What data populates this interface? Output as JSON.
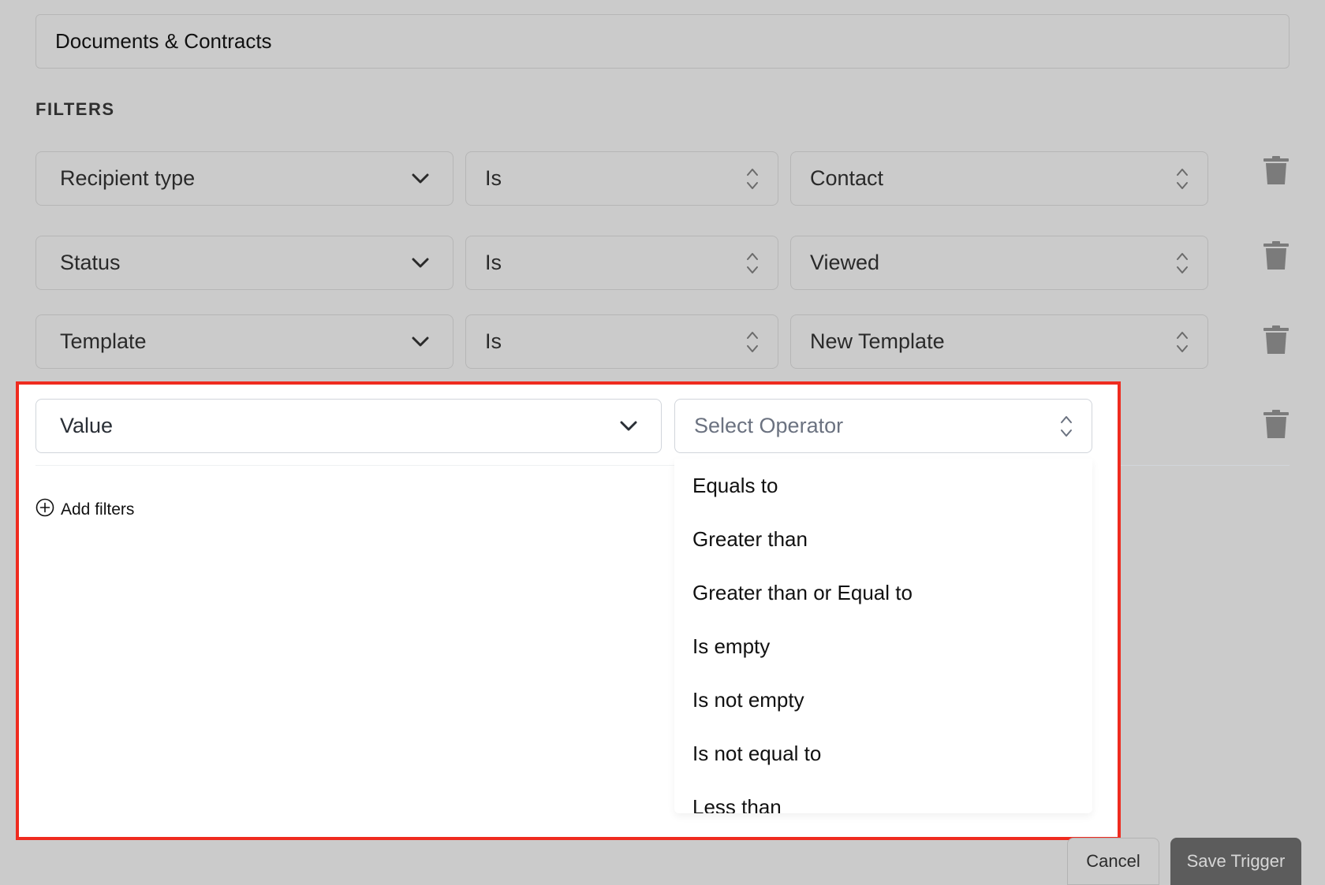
{
  "trigger_name": "Documents & Contracts",
  "filters_heading": "FILTERS",
  "filter_rows": [
    {
      "field": "Recipient type",
      "operator": "Is",
      "value": "Contact"
    },
    {
      "field": "Status",
      "operator": "Is",
      "value": "Viewed"
    },
    {
      "field": "Template",
      "operator": "Is",
      "value": "New Template"
    }
  ],
  "new_filter": {
    "field": "Value",
    "operator_placeholder": "Select Operator"
  },
  "operator_options": [
    "Equals to",
    "Greater than",
    "Greater than or Equal to",
    "Is empty",
    "Is not empty",
    "Is not equal to",
    "Less than"
  ],
  "add_filters_label": "Add filters",
  "buttons": {
    "cancel": "Cancel",
    "save": "Save Trigger"
  },
  "icons": {
    "field_dropdown": "chevron-down-icon",
    "operator_dropdown": "chevron-up-down-icon",
    "delete": "trash-icon",
    "add": "plus-circle-icon"
  },
  "colors": {
    "overlay_background": "#cbcbcb",
    "highlight_border": "#ef2b1f",
    "save_button": "#5c5c5c"
  }
}
